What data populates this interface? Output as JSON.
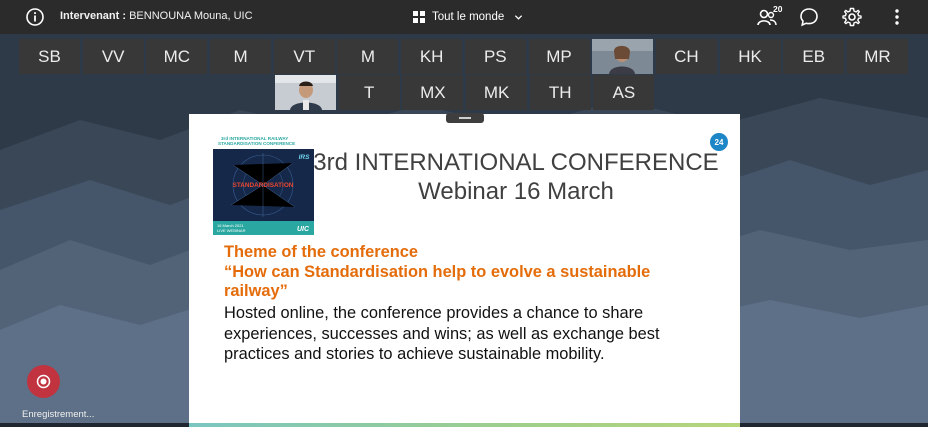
{
  "topbar": {
    "speaker_label": "Intervenant :",
    "speaker_name": "BENNOUNA Mouna, UIC",
    "view_label": "Tout le monde",
    "participants_count": "20"
  },
  "tiles_row1": [
    "SB",
    "VV",
    "MC",
    "M",
    "VT",
    "M",
    "KH",
    "PS",
    "MP",
    "",
    "CH",
    "HK",
    "EB",
    "MR"
  ],
  "tiles_row2": [
    "",
    "T",
    "MX",
    "MK",
    "TH",
    "AS"
  ],
  "slide": {
    "logo_line1": "3rd INTERNATIONAL RAILWAY",
    "logo_line2": "STANDARDISATION CONFERENCE",
    "logo_word": "STANDARDISATION",
    "logo_date": "16 March 2021",
    "logo_sub": "LIVE WEBINAR",
    "logo_brand": "UIC",
    "logo_irs": "IRS",
    "title_line1": "3rd INTERNATIONAL CONFERENCE",
    "title_line2": "Webinar 16 March",
    "page_number": "24",
    "theme_line1": "Theme of the conference",
    "theme_line2": "“How can Standardisation help to evolve a sustainable",
    "theme_line3": "railway”",
    "body_line1": "Hosted online, the conference provides a chance to share",
    "body_line2": "experiences, successes and wins; as well as exchange best",
    "body_line3": "practices and stories to achieve sustainable mobility."
  },
  "recording_label": "Enregistrement..."
}
